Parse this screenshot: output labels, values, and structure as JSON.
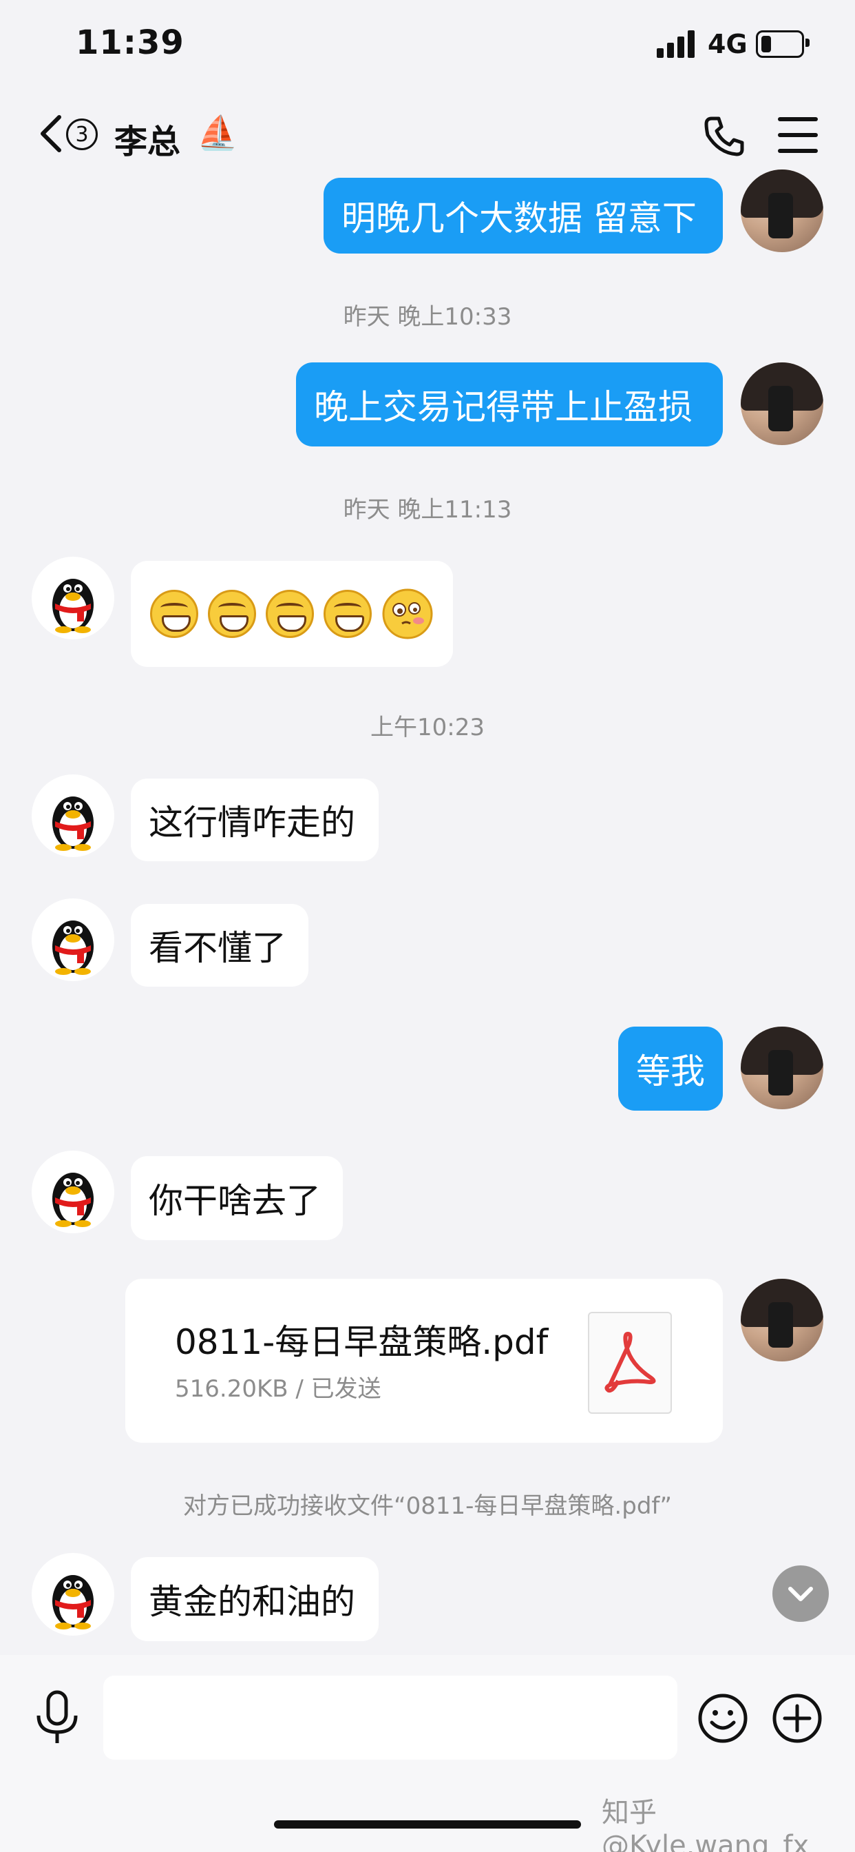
{
  "status_bar": {
    "time": "11:39",
    "network": "4G"
  },
  "nav": {
    "back_badge": "3",
    "contact_name": "李总",
    "contact_emoji": "⛵"
  },
  "messages": {
    "m1": "明晚几个大数据 留意下",
    "t1": "昨天 晚上10:33",
    "m2": "晚上交易记得带上止盈损",
    "t2": "昨天 晚上11:13",
    "t3": "上午10:23",
    "m4": "这行情咋走的",
    "m5": "看不懂了",
    "m6": "等我",
    "m7": "你干啥去了",
    "m8": "黄金的和油的"
  },
  "file": {
    "name": "0811-每日早盘策略.pdf",
    "meta": "516.20KB / 已发送",
    "notice": "对方已成功接收文件“0811-每日早盘策略.pdf”"
  },
  "watermark": "知乎 @Kyle.wang_fx",
  "icons": {
    "back": "chevron-left-icon",
    "call": "phone-icon",
    "menu": "menu-icon",
    "mic": "microphone-icon",
    "emoji": "smile-icon",
    "add": "plus-icon",
    "scroll": "chevron-down-icon"
  },
  "colors": {
    "outgoing_bubble": "#1a9df5",
    "incoming_bubble": "#ffffff",
    "background": "#f3f3f6"
  }
}
